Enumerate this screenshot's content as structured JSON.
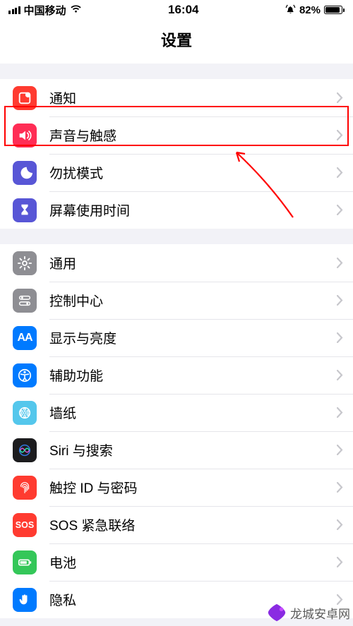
{
  "status": {
    "carrier": "中国移动",
    "time": "16:04",
    "battery_pct": "82%"
  },
  "title": "设置",
  "groups": [
    {
      "items": [
        {
          "id": "notifications",
          "label": "通知",
          "icon": "notifications-icon",
          "color": "#ff3b30"
        },
        {
          "id": "sounds",
          "label": "声音与触感",
          "icon": "sound-icon",
          "color": "#ff2d55",
          "highlighted": true
        },
        {
          "id": "dnd",
          "label": "勿扰模式",
          "icon": "moon-icon",
          "color": "#5856d6"
        },
        {
          "id": "screentime",
          "label": "屏幕使用时间",
          "icon": "hourglass-icon",
          "color": "#5856d6"
        }
      ]
    },
    {
      "items": [
        {
          "id": "general",
          "label": "通用",
          "icon": "gear-icon",
          "color": "#8e8e93"
        },
        {
          "id": "controlcenter",
          "label": "控制中心",
          "icon": "switches-icon",
          "color": "#8e8e93"
        },
        {
          "id": "display",
          "label": "显示与亮度",
          "icon": "aa-icon",
          "color": "#007aff"
        },
        {
          "id": "accessibility",
          "label": "辅助功能",
          "icon": "accessibility-icon",
          "color": "#007aff"
        },
        {
          "id": "wallpaper",
          "label": "墙纸",
          "icon": "wallpaper-icon",
          "color": "#54c7ec"
        },
        {
          "id": "siri",
          "label": "Siri 与搜索",
          "icon": "siri-icon",
          "color": "#1c1c1e"
        },
        {
          "id": "touchid",
          "label": "触控 ID 与密码",
          "icon": "fingerprint-icon",
          "color": "#ff3b30"
        },
        {
          "id": "sos",
          "label": "SOS 紧急联络",
          "icon": "sos-icon",
          "color": "#ff3b30",
          "icon_text": "SOS"
        },
        {
          "id": "battery",
          "label": "电池",
          "icon": "battery-icon",
          "color": "#34c759"
        },
        {
          "id": "privacy",
          "label": "隐私",
          "icon": "hand-icon",
          "color": "#007aff"
        }
      ]
    }
  ],
  "watermark": "龙城安卓网"
}
